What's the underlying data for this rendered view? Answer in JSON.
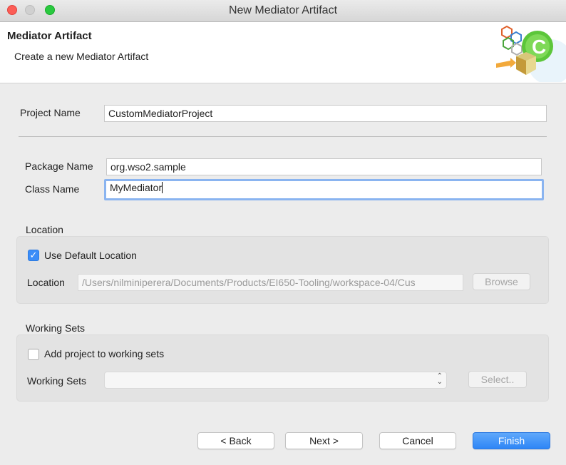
{
  "window": {
    "title": "New Mediator Artifact"
  },
  "header": {
    "title": "Mediator Artifact",
    "subtitle": "Create a new Mediator Artifact"
  },
  "form": {
    "project_name": {
      "label": "Project Name",
      "value": "CustomMediatorProject"
    },
    "package_name": {
      "label": "Package Name",
      "value": "org.wso2.sample"
    },
    "class_name": {
      "label": "Class Name",
      "value": "MyMediator"
    }
  },
  "location_group": {
    "title": "Location",
    "use_default_label": "Use Default Location",
    "use_default_checked": true,
    "location_label": "Location",
    "location_value": "/Users/nilminiperera/Documents/Products/EI650-Tooling/workspace-04/Cus",
    "browse_label": "Browse"
  },
  "working_sets_group": {
    "title": "Working Sets",
    "add_label": "Add project to working sets",
    "add_checked": false,
    "sets_label": "Working Sets",
    "sets_value": "",
    "select_label": "Select.."
  },
  "buttons": {
    "back": "< Back",
    "next": "Next >",
    "cancel": "Cancel",
    "finish": "Finish"
  },
  "colors": {
    "accent": "#3b8df8",
    "focus_ring": "#8ab4f0",
    "close": "#fc5d56",
    "maximize": "#2ac940"
  }
}
